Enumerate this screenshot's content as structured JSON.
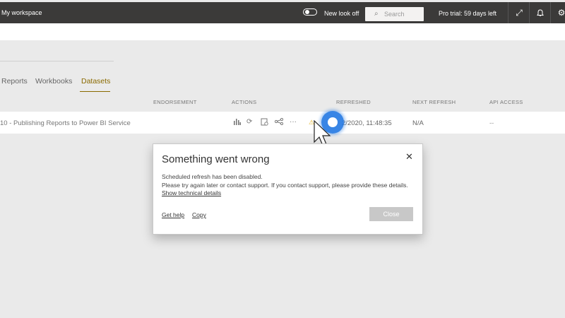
{
  "topbar": {
    "workspace": "My workspace",
    "new_look_label": "New look off",
    "search_placeholder": "Search",
    "trial": "Pro trial: 59 days left",
    "icons": [
      "expand-icon",
      "bell-icon",
      "gear-icon"
    ]
  },
  "tabs": [
    {
      "label": "Reports"
    },
    {
      "label": "Workbooks"
    },
    {
      "label": "Datasets",
      "active": true
    }
  ],
  "columns": {
    "endorsement": "ENDORSEMENT",
    "actions": "ACTIONS",
    "refreshed": "REFRESHED",
    "next_refresh": "NEXT REFRESH",
    "api_access": "API ACCESS"
  },
  "row": {
    "name": "10 - Publishing Reports to Power BI Service",
    "refreshed": "2/2020, 11:48:35",
    "next_refresh": "N/A",
    "api_access": "--",
    "action_icons": [
      "chart-icon",
      "refresh-icon",
      "schedule-icon",
      "share-icon",
      "more-icon"
    ]
  },
  "dialog": {
    "title": "Something went wrong",
    "line1": "Scheduled refresh has been disabled.",
    "line2": "Please try again later or contact support. If you contact support, please provide these details.",
    "details_link": "Show technical details",
    "get_help": "Get help",
    "copy": "Copy",
    "close_button": "Close"
  },
  "colors": {
    "topbar": "#3b3a39",
    "accent": "#8a6a00",
    "click_indicator": "#2278e2",
    "warning": "#e3b01a"
  }
}
